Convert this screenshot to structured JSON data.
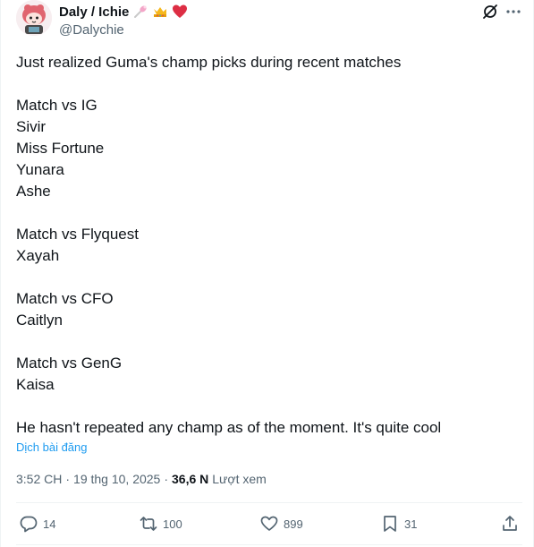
{
  "author": {
    "display_name": "Daly / Ichie",
    "handle": "@Dalychie",
    "name_emojis": [
      "pin-emoji",
      "crown-emoji",
      "red-heart-emoji"
    ]
  },
  "header_icons": [
    "grok-icon",
    "more-icon"
  ],
  "tweet": {
    "text": "Just realized Guma's champ picks during recent matches\n\nMatch vs IG\nSivir\nMiss Fortune\nYunara\nAshe\n\nMatch vs Flyquest\nXayah\n\nMatch vs CFO\nCaitlyn\n\nMatch vs GenG\nKaisa\n\nHe hasn't repeated any champ as of the moment. It's quite cool",
    "translate_label": "Dịch bài đăng"
  },
  "meta": {
    "time": "3:52 CH",
    "separator1": "·",
    "date": "19 thg 10, 2025",
    "separator2": "·",
    "views_count": "36,6 N",
    "views_label": "Lượt xem"
  },
  "actions": {
    "reply_count": "14",
    "retweet_count": "100",
    "like_count": "899",
    "bookmark_count": "31"
  },
  "colors": {
    "text": "#0f1419",
    "secondary": "#536471",
    "link": "#1d9bf0",
    "divider": "#eff3f4"
  }
}
